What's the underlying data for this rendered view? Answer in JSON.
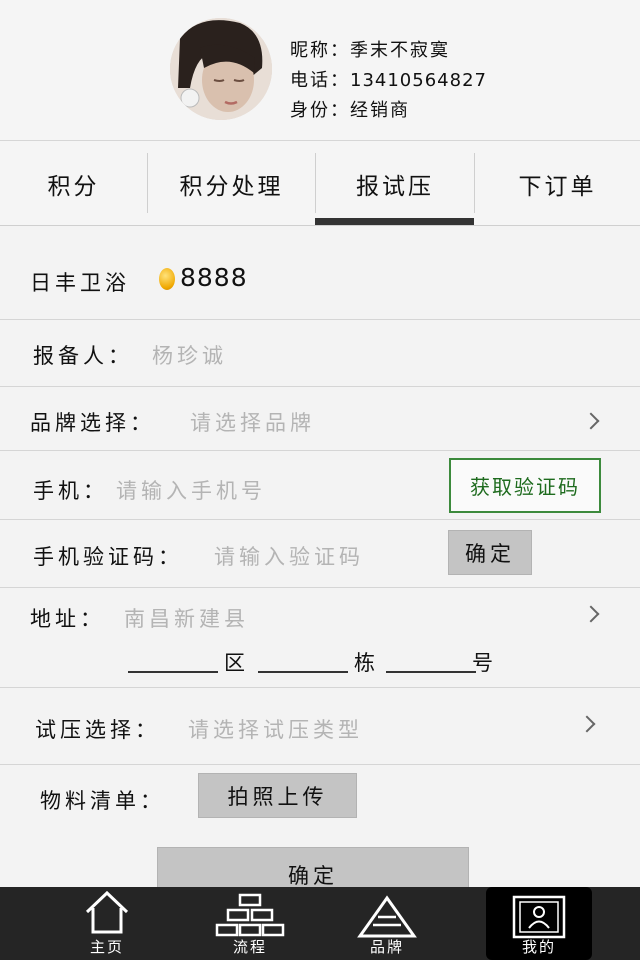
{
  "profile": {
    "nickname_label": "昵称：",
    "nickname": "季末不寂寞",
    "phone_label": "电话：",
    "phone": "13410564827",
    "identity_label": "身份：",
    "identity": "经销商"
  },
  "tabs": [
    {
      "label": "积分"
    },
    {
      "label": "积分处理"
    },
    {
      "label": "报试压",
      "active": true
    },
    {
      "label": "下订单"
    }
  ],
  "form": {
    "brand_name": "日丰卫浴",
    "points": "8888",
    "reporter_label": "报备人：",
    "reporter_value": "杨珍诚",
    "brand_label": "品牌选择：",
    "brand_placeholder": "请选择品牌",
    "phone_label": "手机：",
    "phone_placeholder": "请输入手机号",
    "get_code_button": "获取验证码",
    "code_label": "手机验证码：",
    "code_placeholder": "请输入验证码",
    "code_confirm_button": "确定",
    "address_label": "地址：",
    "address_value": "南昌新建县",
    "address_district": "区",
    "address_building": "栋",
    "address_number": "号",
    "test_label": "试压选择：",
    "test_placeholder": "请选择试压类型",
    "materials_label": "物料清单：",
    "upload_button": "拍照上传",
    "submit_button": "确定"
  },
  "bottom_nav": [
    {
      "label": "主页",
      "icon": "home-icon"
    },
    {
      "label": "流程",
      "icon": "flow-icon"
    },
    {
      "label": "品牌",
      "icon": "brand-icon"
    },
    {
      "label": "我的",
      "icon": "profile-card-icon",
      "active": true
    }
  ],
  "colors": {
    "accent_green": "#1e6b1e",
    "nav_background": "#252525",
    "placeholder": "#b4b4b4"
  }
}
